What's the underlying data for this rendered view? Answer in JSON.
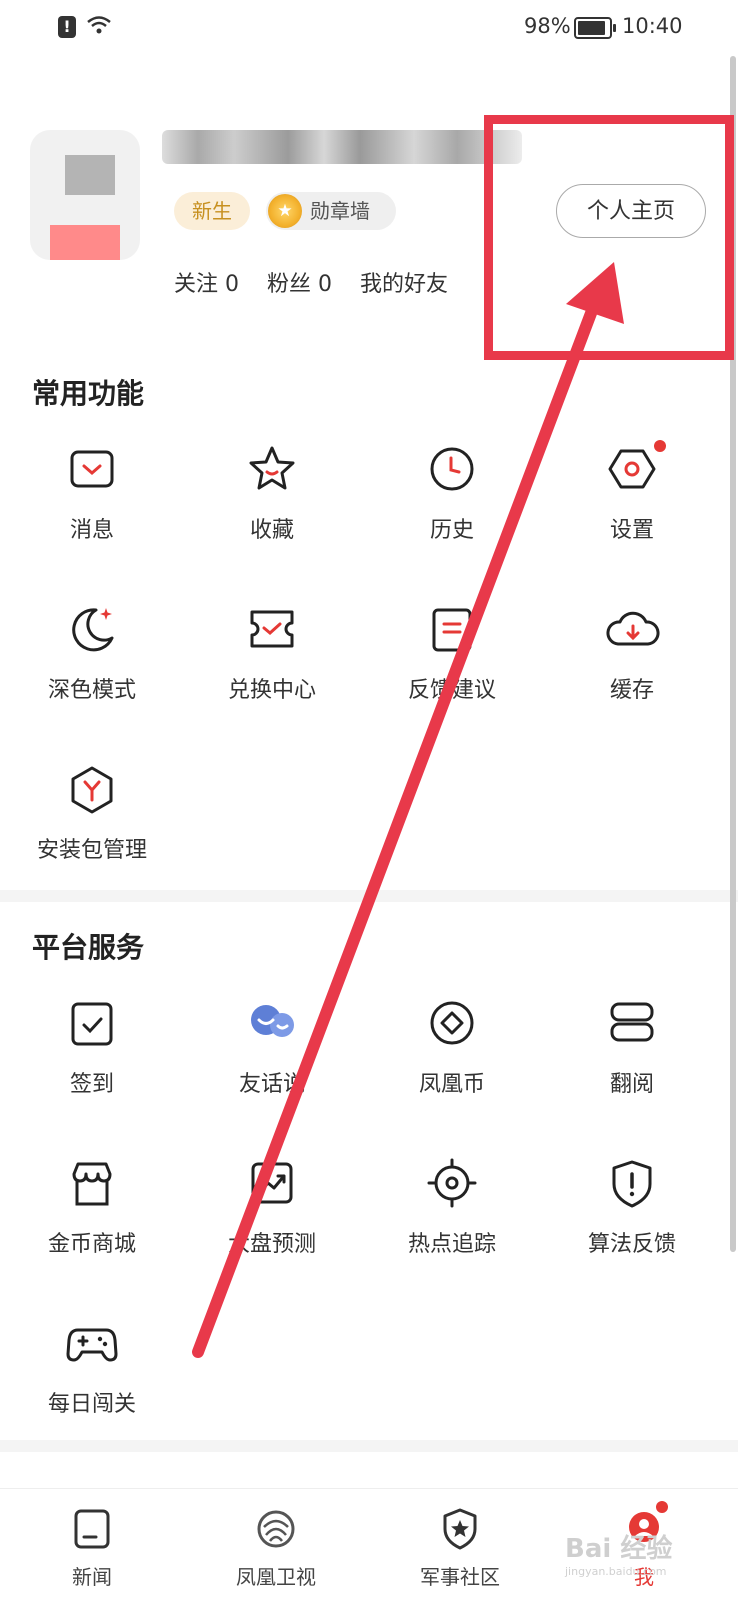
{
  "status_bar": {
    "battery": "98%",
    "time": "10:40"
  },
  "profile": {
    "badge_new": "新生",
    "badge_medal": "勋章墙",
    "home_button": "个人主页",
    "follow": "关注 0",
    "fans": "粉丝 0",
    "friends": "我的好友"
  },
  "common": {
    "title": "常用功能",
    "items": [
      {
        "label": "消息",
        "icon": "message-icon"
      },
      {
        "label": "收藏",
        "icon": "star-icon"
      },
      {
        "label": "历史",
        "icon": "clock-icon"
      },
      {
        "label": "设置",
        "icon": "settings-icon"
      },
      {
        "label": "深色模式",
        "icon": "moon-icon"
      },
      {
        "label": "兑换中心",
        "icon": "ticket-icon"
      },
      {
        "label": "反馈建议",
        "icon": "feedback-icon"
      },
      {
        "label": "缓存",
        "icon": "cloud-download-icon"
      },
      {
        "label": "安装包管理",
        "icon": "package-icon"
      }
    ]
  },
  "platform": {
    "title": "平台服务",
    "items": [
      {
        "label": "签到",
        "icon": "checkin-icon"
      },
      {
        "label": "友话说",
        "icon": "chat-bubbles-icon"
      },
      {
        "label": "凤凰币",
        "icon": "coin-icon"
      },
      {
        "label": "翻阅",
        "icon": "book-icon"
      },
      {
        "label": "金币商城",
        "icon": "store-icon"
      },
      {
        "label": "大盘预测",
        "icon": "trend-icon"
      },
      {
        "label": "热点追踪",
        "icon": "target-icon"
      },
      {
        "label": "算法反馈",
        "icon": "shield-alert-icon"
      },
      {
        "label": "每日闯关",
        "icon": "gamepad-icon"
      }
    ]
  },
  "tabbar": {
    "items": [
      {
        "label": "新闻",
        "icon": "news-icon"
      },
      {
        "label": "凤凰卫视",
        "icon": "phoenix-icon"
      },
      {
        "label": "军事社区",
        "icon": "military-shield-icon"
      },
      {
        "label": "我",
        "icon": "me-icon"
      }
    ],
    "active_index": 3
  },
  "colors": {
    "accent": "#e53935",
    "annotation": "#e8394a"
  }
}
